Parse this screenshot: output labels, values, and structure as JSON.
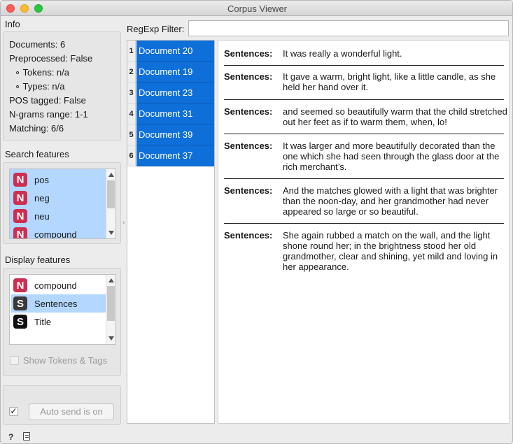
{
  "window": {
    "title": "Corpus Viewer"
  },
  "info": {
    "heading": "Info",
    "lines": [
      "Documents: 6",
      "Preprocessed: False",
      "∘ Tokens: n/a",
      "∘ Types: n/a",
      "POS tagged: False",
      "N-grams range: 1-1",
      "Matching: 6/6"
    ]
  },
  "search_features": {
    "heading": "Search features",
    "items": [
      {
        "type": "N",
        "label": "pos"
      },
      {
        "type": "N",
        "label": "neg"
      },
      {
        "type": "N",
        "label": "neu"
      },
      {
        "type": "N",
        "label": "compound"
      }
    ]
  },
  "display_features": {
    "heading": "Display features",
    "items": [
      {
        "type": "N",
        "label": "compound"
      },
      {
        "type": "S",
        "label": "Sentences"
      },
      {
        "type": "S",
        "label": "Title"
      }
    ],
    "show_tokens_label": "Show Tokens & Tags"
  },
  "auto_send": {
    "checked_glyph": "✓",
    "button_label": "Auto send is on"
  },
  "filter": {
    "label": "RegExp Filter:",
    "value": ""
  },
  "documents": [
    {
      "num": "1",
      "title": "Document 20"
    },
    {
      "num": "2",
      "title": "Document 19"
    },
    {
      "num": "3",
      "title": "Document 23"
    },
    {
      "num": "4",
      "title": "Document 31"
    },
    {
      "num": "5",
      "title": "Document 39"
    },
    {
      "num": "6",
      "title": "Document 37"
    }
  ],
  "content": {
    "field_label": "Sentences:",
    "sentences": [
      "It was really a wonderful light.",
      "It gave a warm, bright light, like a little candle, as she held her hand over it.",
      "and seemed so beautifully warm that the child stretched out her feet as if to warm them, when, lo!",
      "It was larger and more beautifully decorated than the one which she had seen through the glass door at the rich merchant’s.",
      "And the matches glowed with a light that was brighter than the noon-day, and her grandmother had never appeared so large or so beautiful.",
      "She again rubbed a match on the wall, and the light shone round her; in the brightness stood her old grandmother, clear and shining, yet mild and loving in her appearance."
    ]
  },
  "status_bar": {
    "help_icon": "?",
    "report_icon": "report-icon"
  }
}
